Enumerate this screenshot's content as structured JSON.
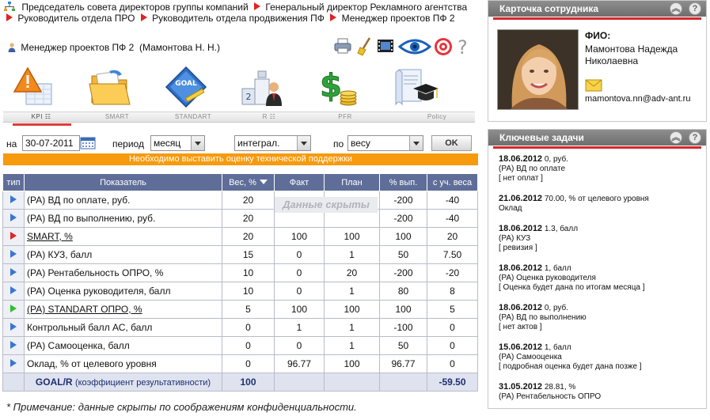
{
  "breadcrumb": {
    "items": [
      "Председатель совета директоров группы компаний",
      "Генеральный директор Рекламного агентства",
      "Руководитель отдела ПРО",
      "Руководитель отдела продвижения ПФ",
      "Менеджер проектов ПФ 2"
    ]
  },
  "user": {
    "position": "Менеджер проектов ПФ 2",
    "name": "(Мамонтова Н. Н.)"
  },
  "toolbar": {
    "icons": [
      "printer-icon",
      "broom-icon",
      "film-icon",
      "eye-icon",
      "target-icon",
      "help-icon"
    ],
    "help": "?"
  },
  "modules": [
    {
      "label": "KPI",
      "icon": "kpi-warning-icon",
      "active": true
    },
    {
      "label": "SMART",
      "icon": "folder-icon",
      "active": false
    },
    {
      "label": "STANDART",
      "icon": "goal-icon",
      "active": false
    },
    {
      "label": "R",
      "icon": "ranking-icon",
      "active": false
    },
    {
      "label": "PFR",
      "icon": "money-icon",
      "active": false
    },
    {
      "label": "Policy",
      "icon": "graduation-icon",
      "active": false
    }
  ],
  "filters": {
    "date_label": "на",
    "date_value": "30-07-2011",
    "period_label": "период",
    "period_value": "месяц",
    "mode_value": "интеграл.",
    "by_label": "по",
    "by_value": "весу",
    "ok": "OK"
  },
  "warning": "Необходимо выставить оценку технической поддержки",
  "table": {
    "headers": [
      "тип",
      "Показатель",
      "Вес, %",
      "Факт",
      "План",
      "% вып.",
      "с уч. веса"
    ],
    "hidden_note": "Данные скрыты",
    "rows": [
      {
        "type": "blue",
        "name": "(РА) ВД по оплате, руб.",
        "link": false,
        "weight": "20",
        "fact": "",
        "plan": "",
        "pct": "-200",
        "weighted": "-40"
      },
      {
        "type": "blue",
        "name": "(РА) ВД по выполнению, руб.",
        "link": false,
        "weight": "20",
        "fact": "",
        "plan": "",
        "pct": "-200",
        "weighted": "-40"
      },
      {
        "type": "red",
        "name": "SMART, %",
        "link": true,
        "weight": "20",
        "fact": "100",
        "plan": "100",
        "pct": "100",
        "weighted": "20"
      },
      {
        "type": "blue",
        "name": "(РА) КУЗ, балл",
        "link": false,
        "weight": "15",
        "fact": "0",
        "plan": "1",
        "pct": "50",
        "weighted": "7.50"
      },
      {
        "type": "blue",
        "name": "(РА) Рентабельность ОПРО, %",
        "link": false,
        "weight": "10",
        "fact": "0",
        "plan": "20",
        "pct": "-200",
        "weighted": "-20"
      },
      {
        "type": "blue",
        "name": "(РА) Оценка руководителя, балл",
        "link": false,
        "weight": "10",
        "fact": "0",
        "plan": "1",
        "pct": "80",
        "weighted": "8"
      },
      {
        "type": "green",
        "name": "(РА) STANDART ОПРО, %",
        "link": true,
        "weight": "5",
        "fact": "100",
        "plan": "100",
        "pct": "100",
        "weighted": "5"
      },
      {
        "type": "blue",
        "name": "Контрольный балл АС, балл",
        "link": false,
        "weight": "0",
        "fact": "1",
        "plan": "1",
        "pct": "-100",
        "weighted": "0"
      },
      {
        "type": "blue",
        "name": "(РА) Самооценка, балл",
        "link": false,
        "weight": "0",
        "fact": "0",
        "plan": "1",
        "pct": "50",
        "weighted": "0"
      },
      {
        "type": "blue",
        "name": "Оклад, % от целевого уровня",
        "link": false,
        "weight": "0",
        "fact": "96.77",
        "plan": "100",
        "pct": "96.77",
        "weighted": "0"
      }
    ],
    "total": {
      "goal": "GOAL/R",
      "goal_desc": "(коэффициент результативности)",
      "weight": "100",
      "weighted": "-59.50"
    }
  },
  "footnote": "* Примечание: данные скрыты по соображениям конфиденциальности.",
  "employee_card": {
    "title": "Карточка сотрудника",
    "fio_label": "ФИО:",
    "fio": "Мамонтова Надежда Николаевна",
    "email": "mamontova.nn@adv-ant.ru"
  },
  "key_tasks": {
    "title": "Ключевые задачи",
    "items": [
      {
        "date": "18.06.2012",
        "value": "0, руб.",
        "name": "(РА) ВД по оплате",
        "note": "[ нет оплат ]"
      },
      {
        "date": "21.06.2012",
        "value": "70.00, % от целевого уровня",
        "name": "Оклад",
        "note": ""
      },
      {
        "date": "18.06.2012",
        "value": "1.3, балл",
        "name": "(РА) КУЗ",
        "note": "[ ревизия ]"
      },
      {
        "date": "18.06.2012",
        "value": "1, балл",
        "name": "(РА) Оценка руководителя",
        "note": "[ Оценка будет дана по итогам месяца ]"
      },
      {
        "date": "18.06.2012",
        "value": "0, руб.",
        "name": "(РА) ВД по выполнению",
        "note": "[ нет актов ]"
      },
      {
        "date": "15.06.2012",
        "value": "1, балл",
        "name": "(РА) Самооценка",
        "note": "[ подробная оценка будет дана позже ]"
      },
      {
        "date": "31.05.2012",
        "value": "28.81, %",
        "name": "(РА) Рентабельность ОПРО",
        "note": ""
      }
    ]
  }
}
